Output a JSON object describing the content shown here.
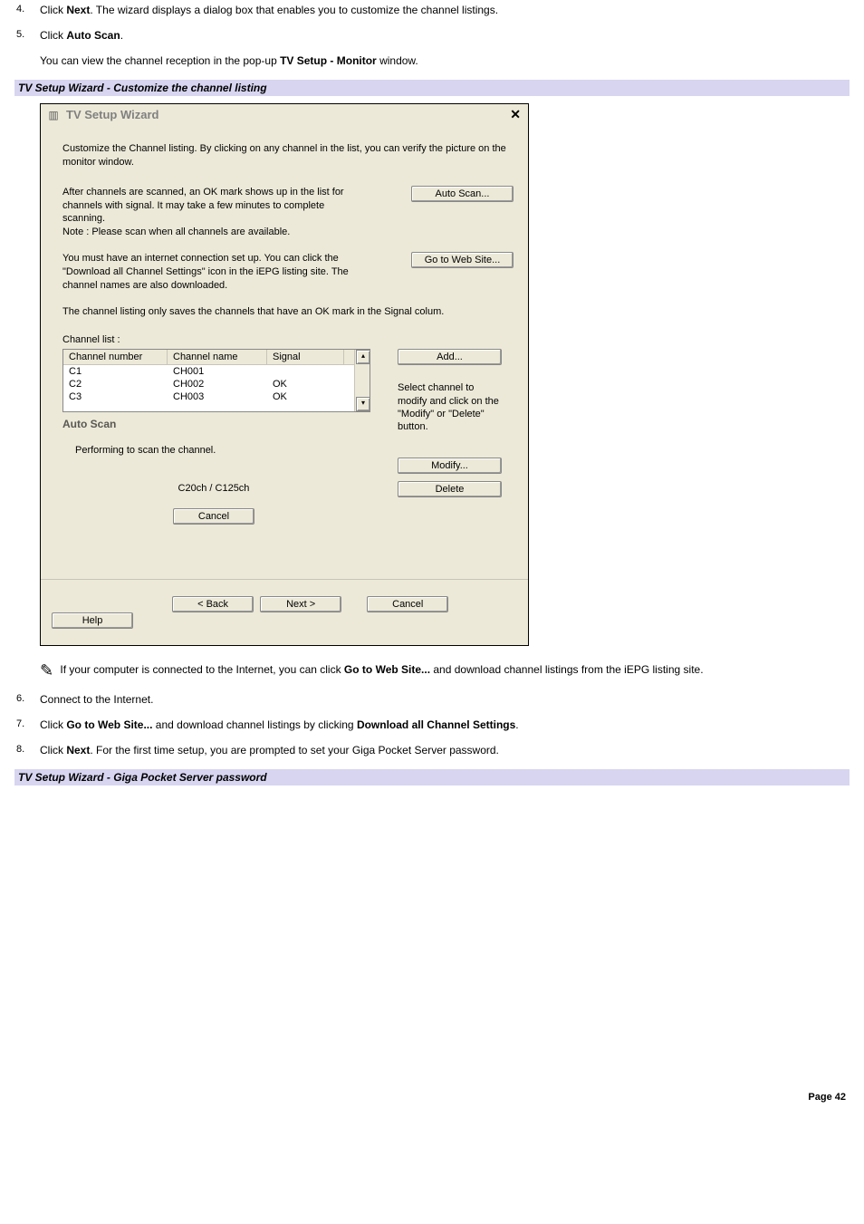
{
  "steps": {
    "s4": {
      "num": "4.",
      "text_a": "Click ",
      "bold_a": "Next",
      "text_b": ". The wizard displays a dialog box that enables you to customize the channel listings."
    },
    "s5": {
      "num": "5.",
      "text_a": "Click ",
      "bold_a": "Auto Scan",
      "text_b": ".",
      "sub_a": "You can view the channel reception in the pop-up ",
      "sub_bold": "TV Setup - Monitor",
      "sub_b": " window."
    },
    "s6": {
      "num": "6.",
      "text": "Connect to the Internet."
    },
    "s7": {
      "num": "7.",
      "text_a": "Click ",
      "bold_a": "Go to Web Site...",
      "text_b": " and download channel listings by clicking ",
      "bold_b": "Download all Channel Settings",
      "text_c": "."
    },
    "s8": {
      "num": "8.",
      "text_a": "Click ",
      "bold_a": "Next",
      "text_b": ". For the first time setup, you are prompted to set your Giga Pocket Server password."
    }
  },
  "section1": "TV Setup Wizard - Customize the channel listing",
  "section2": "TV Setup Wizard - Giga Pocket Server password",
  "dialog": {
    "title": "TV Setup Wizard",
    "intro": "Customize the Channel listing. By clicking on any channel in the list, you can verify the picture on the monitor window.",
    "scan_text": "After channels are scanned, an OK mark shows up in the list for channels with signal. It may take a few minutes to complete scanning.\nNote : Please scan when all channels are available.",
    "scan_btn": "Auto Scan...",
    "web_text": "You must have an internet connection set up. You can click the \"Download all Channel Settings\" icon in the iEPG listing site. The channel names are also downloaded.",
    "web_btn": "Go to Web Site...",
    "save_note": "The channel listing only saves the channels that have an OK mark in the Signal colum.",
    "list_label": "Channel list :",
    "headers": {
      "num": "Channel number",
      "name": "Channel name",
      "sig": "Signal"
    },
    "rows": [
      {
        "num": "C1",
        "name": "CH001",
        "sig": ""
      },
      {
        "num": "C2",
        "name": "CH002",
        "sig": "OK"
      },
      {
        "num": "C3",
        "name": "CH003",
        "sig": "OK"
      }
    ],
    "add_btn": "Add...",
    "help_text": "Select channel to modify and click on the \"Modify\" or \"Delete\" button.",
    "modify_btn": "Modify...",
    "delete_btn": "Delete",
    "autoscan": {
      "title": "Auto Scan",
      "line": "Performing to scan the channel.",
      "progress": "C20ch / C125ch",
      "cancel": "Cancel"
    },
    "footer": {
      "back": "< Back",
      "next": "Next >",
      "cancel": "Cancel",
      "help": "Help"
    }
  },
  "note": {
    "a": " If your computer is connected to the Internet, you can click ",
    "bold": "Go to Web Site...",
    "b": " and download channel listings from the iEPG listing site."
  },
  "page_num": "Page 42"
}
